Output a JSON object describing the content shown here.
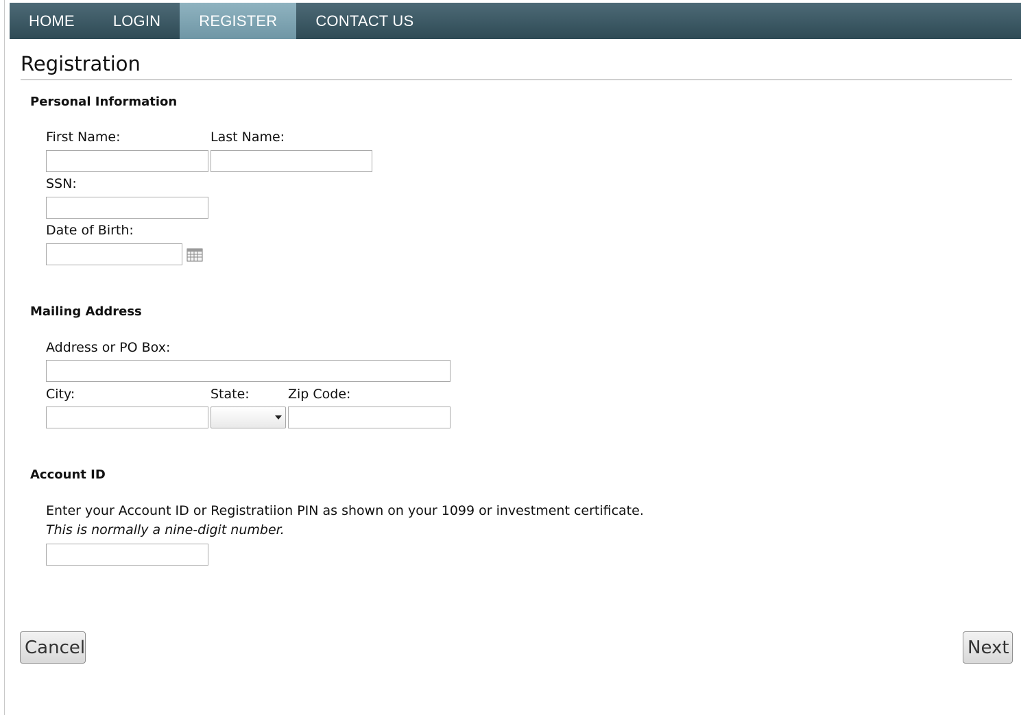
{
  "nav": {
    "items": [
      {
        "label": "HOME"
      },
      {
        "label": "LOGIN"
      },
      {
        "label": "REGISTER"
      },
      {
        "label": "CONTACT US"
      }
    ],
    "active": "REGISTER"
  },
  "page": {
    "title": "Registration"
  },
  "personal": {
    "heading": "Personal Information",
    "first_name_label": "First Name:",
    "last_name_label": "Last Name:",
    "ssn_label": "SSN:",
    "dob_label": "Date of Birth:",
    "first_name_value": "",
    "last_name_value": "",
    "ssn_value": "",
    "dob_value": ""
  },
  "mailing": {
    "heading": "Mailing Address",
    "address_label": "Address or PO Box:",
    "city_label": "City:",
    "state_label": "State:",
    "zip_label": "Zip Code:",
    "address_value": "",
    "city_value": "",
    "state_value": "",
    "zip_value": ""
  },
  "account": {
    "heading": "Account ID",
    "instruction": "Enter your Account ID or Registratiion PIN as shown on your 1099 or investment certificate.",
    "note": "This is normally a nine-digit number.",
    "account_id_value": ""
  },
  "buttons": {
    "cancel": "Cancel",
    "next": "Next"
  },
  "colors": {
    "nav_bg": "#3a5763",
    "nav_active": "#7ea3b2",
    "text": "#111111"
  },
  "icons": {
    "calendar": "calendar-icon",
    "dropdown": "chevron-down-icon"
  }
}
